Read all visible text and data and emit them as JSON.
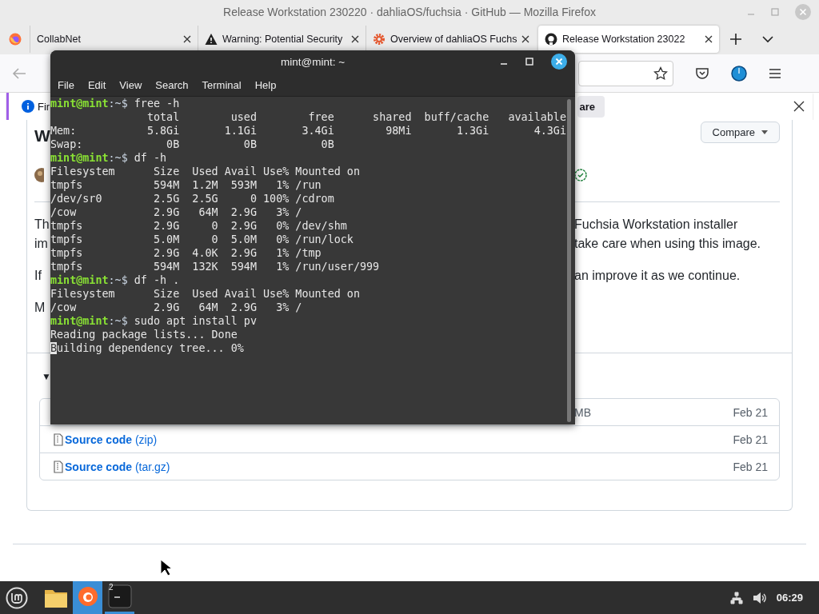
{
  "window": {
    "title": "Release Workstation 230220 · dahliaOS/fuchsia · GitHub — Mozilla Firefox"
  },
  "tabs": [
    {
      "label": "CollabNet",
      "kind": "none",
      "selected": false
    },
    {
      "label": "Warning: Potential Security",
      "kind": "warning",
      "selected": false
    },
    {
      "label": "Overview of dahliaOS Fuchs",
      "kind": "gear",
      "selected": false
    },
    {
      "label": "Release Workstation 23022",
      "kind": "github",
      "selected": true
    }
  ],
  "notification": {
    "text": "Fir",
    "button": "are"
  },
  "page": {
    "heading": "W",
    "compare_button": "Compare",
    "paragraphs": [
      {
        "left": "Th",
        "right": "Fuchsia Workstation installer"
      },
      {
        "left": "im",
        "right": "take care when using this image."
      },
      {
        "left": "If",
        "right": "an improve it as we continue."
      },
      {
        "left": "M"
      }
    ],
    "assets_toggle": "▼",
    "assets": [
      {
        "kind": "size",
        "size": "MB",
        "date": "Feb 21"
      },
      {
        "kind": "source",
        "name": "**Source code** (zip)",
        "date": "Feb 21"
      },
      {
        "kind": "source",
        "name": "**Source code** (tar.gz)",
        "date": "Feb 21"
      }
    ]
  },
  "terminal": {
    "title": "mint@mint: ~",
    "menu": [
      "File",
      "Edit",
      "View",
      "Search",
      "Terminal",
      "Help"
    ],
    "lines": [
      {
        "kind": "prompt",
        "user": "mint@mint",
        "path": ":~$",
        "command": " free -h",
        "cursor": false
      },
      {
        "kind": "output",
        "text": "               total        used        free      shared  buff/cache   available",
        "cursor": false
      },
      {
        "kind": "output",
        "text": "Mem:           5.8Gi       1.1Gi       3.4Gi        98Mi       1.3Gi       4.3Gi",
        "cursor": false
      },
      {
        "kind": "output",
        "text": "Swap:             0B          0B          0B",
        "cursor": false
      },
      {
        "kind": "prompt",
        "user": "mint@mint",
        "path": ":~$",
        "command": " df -h",
        "cursor": false
      },
      {
        "kind": "output",
        "text": "Filesystem      Size  Used Avail Use% Mounted on",
        "cursor": false
      },
      {
        "kind": "output",
        "text": "tmpfs           594M  1.2M  593M   1% /run",
        "cursor": false
      },
      {
        "kind": "output",
        "text": "/dev/sr0        2.5G  2.5G     0 100% /cdrom",
        "cursor": false
      },
      {
        "kind": "output",
        "text": "/cow            2.9G   64M  2.9G   3% /",
        "cursor": false
      },
      {
        "kind": "output",
        "text": "tmpfs           2.9G     0  2.9G   0% /dev/shm",
        "cursor": false
      },
      {
        "kind": "output",
        "text": "tmpfs           5.0M     0  5.0M   0% /run/lock",
        "cursor": false
      },
      {
        "kind": "output",
        "text": "tmpfs           2.9G  4.0K  2.9G   1% /tmp",
        "cursor": false
      },
      {
        "kind": "output",
        "text": "tmpfs           594M  132K  594M   1% /run/user/999",
        "cursor": false
      },
      {
        "kind": "prompt",
        "user": "mint@mint",
        "path": ":~$",
        "command": " df -h .",
        "cursor": false
      },
      {
        "kind": "output",
        "text": "Filesystem      Size  Used Avail Use% Mounted on",
        "cursor": false
      },
      {
        "kind": "output",
        "text": "/cow            2.9G   64M  2.9G   3% /",
        "cursor": false
      },
      {
        "kind": "prompt",
        "user": "mint@mint",
        "path": ":~$",
        "command": " sudo apt install pv",
        "cursor": false
      },
      {
        "kind": "output",
        "text": "Reading package lists... Done",
        "cursor": false
      },
      {
        "kind": "output",
        "text": "Building dependency tree... 0%",
        "cursor": true
      }
    ]
  },
  "taskbar": {
    "apps": [
      {
        "kind": "files",
        "highlighted": false,
        "open": false
      },
      {
        "kind": "firefox",
        "highlighted": true,
        "open": true
      },
      {
        "kind": "terminal",
        "highlighted": false,
        "open": true,
        "badge": "2"
      }
    ],
    "time": "06:29"
  }
}
